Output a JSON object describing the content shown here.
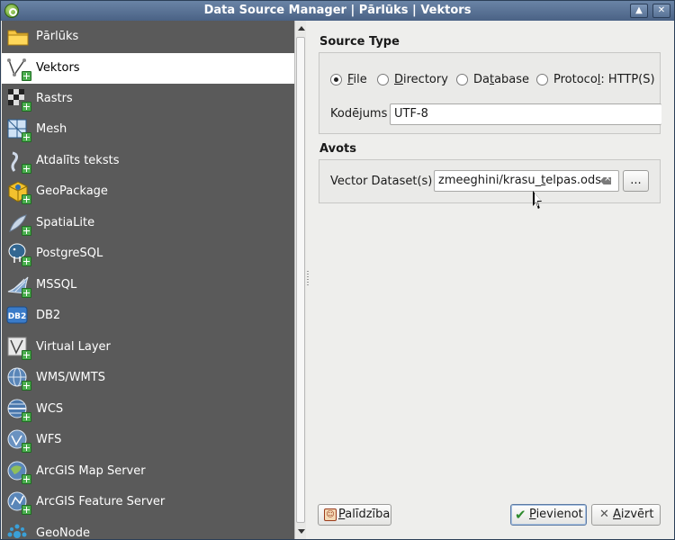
{
  "window": {
    "title": "Data Source Manager | Pārlūks | Vektors"
  },
  "sidebar": {
    "items": [
      {
        "label": "Pārlūks",
        "icon": "folder-icon",
        "selected": false
      },
      {
        "label": "Vektors",
        "icon": "vector-layer-icon",
        "selected": true
      },
      {
        "label": "Rastrs",
        "icon": "raster-layer-icon",
        "selected": false
      },
      {
        "label": "Mesh",
        "icon": "mesh-layer-icon",
        "selected": false
      },
      {
        "label": "Atdalīts teksts",
        "icon": "delimited-text-icon",
        "selected": false
      },
      {
        "label": "GeoPackage",
        "icon": "geopackage-icon",
        "selected": false
      },
      {
        "label": "SpatiaLite",
        "icon": "spatialite-icon",
        "selected": false
      },
      {
        "label": "PostgreSQL",
        "icon": "postgresql-icon",
        "selected": false
      },
      {
        "label": "MSSQL",
        "icon": "mssql-icon",
        "selected": false
      },
      {
        "label": "DB2",
        "icon": "db2-icon",
        "selected": false
      },
      {
        "label": "Virtual Layer",
        "icon": "virtual-layer-icon",
        "selected": false
      },
      {
        "label": "WMS/WMTS",
        "icon": "wms-globe-icon",
        "selected": false
      },
      {
        "label": "WCS",
        "icon": "wcs-globe-icon",
        "selected": false
      },
      {
        "label": "WFS",
        "icon": "wfs-globe-icon",
        "selected": false
      },
      {
        "label": "ArcGIS Map Server",
        "icon": "arcgis-map-server-icon",
        "selected": false
      },
      {
        "label": "ArcGIS Feature Server",
        "icon": "arcgis-feature-server-icon",
        "selected": false
      },
      {
        "label": "GeoNode",
        "icon": "geonode-icon",
        "selected": false
      }
    ]
  },
  "source_type": {
    "title": "Source Type",
    "options": [
      {
        "pre": "",
        "key": "F",
        "post": "ile",
        "checked": true
      },
      {
        "pre": "",
        "key": "D",
        "post": "irectory",
        "checked": false
      },
      {
        "pre": "Da",
        "key": "t",
        "post": "abase",
        "checked": false
      },
      {
        "pre": "Protoco",
        "key": "l",
        "post": ": HTTP(S)",
        "checked": false
      }
    ],
    "encoding_label": "Kodējums",
    "encoding_value": "UTF-8"
  },
  "source": {
    "title": "Avots",
    "dataset_label": "Vector Dataset(s)",
    "dataset_pre": "zmeeghini/krasu_",
    "dataset_key": "t",
    "dataset_post": "elpas.ods",
    "browse_label": "..."
  },
  "buttons": {
    "help": {
      "pre": "",
      "key": "P",
      "post": "alīdzība"
    },
    "add": {
      "pre": "",
      "key": "P",
      "post": "ievienot"
    },
    "close": {
      "pre": "",
      "key": "A",
      "post": "izvērt"
    }
  },
  "colors": {
    "titlebar": "#4a6285",
    "sidebar": "#5a5a5a",
    "selected_item": "#ffffff"
  }
}
